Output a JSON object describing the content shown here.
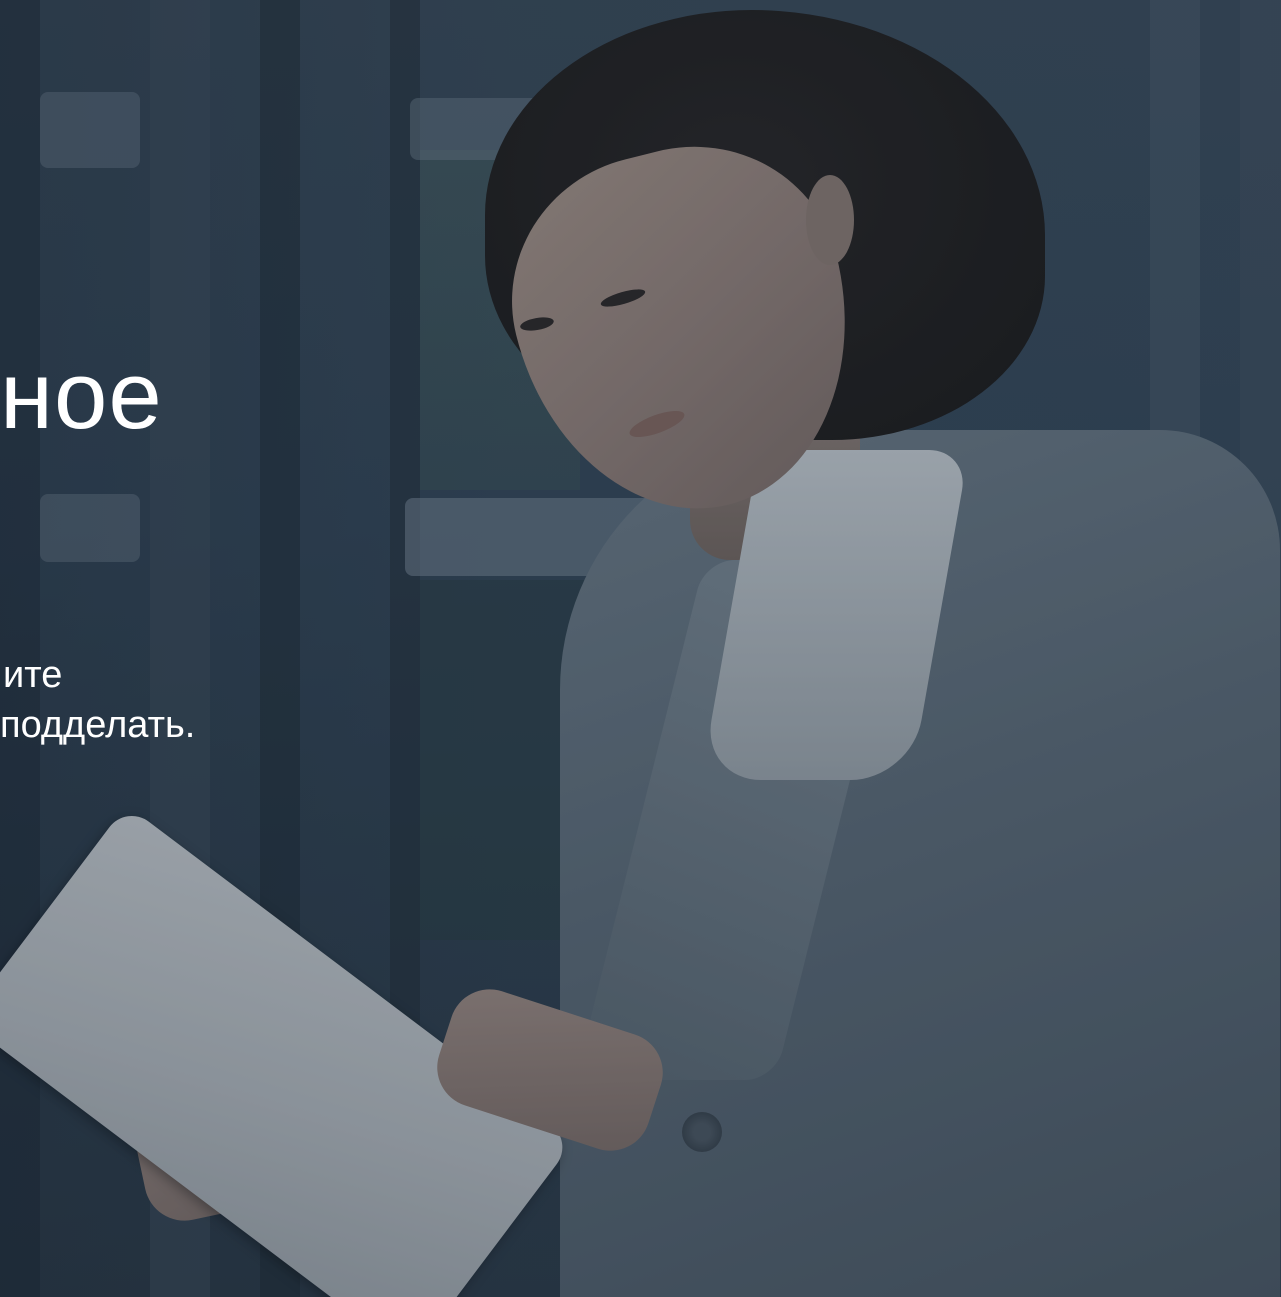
{
  "hero": {
    "headline": "ное",
    "subtext": {
      "line1": "ите",
      "line2": "подделать."
    },
    "image": "businesswoman-with-tablet-photo"
  }
}
